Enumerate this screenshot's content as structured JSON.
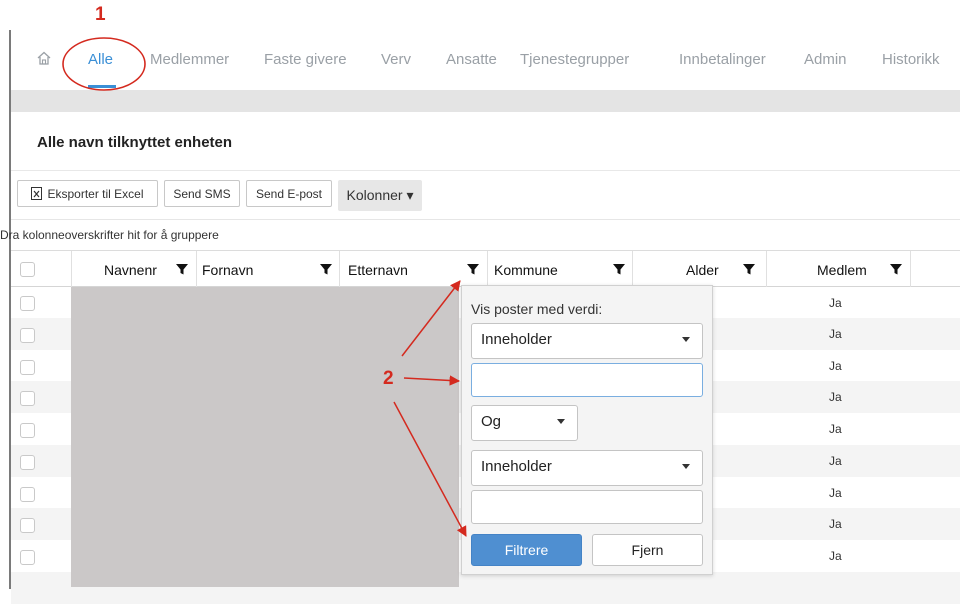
{
  "nav": {
    "items": [
      {
        "label": "Alle",
        "active": true
      },
      {
        "label": "Medlemmer"
      },
      {
        "label": "Faste givere"
      },
      {
        "label": "Verv"
      },
      {
        "label": "Ansatte"
      },
      {
        "label": "Tjenestegrupper"
      },
      {
        "label": "Innbetalinger"
      },
      {
        "label": "Admin"
      },
      {
        "label": "Historikk"
      }
    ],
    "home_icon": "home-icon"
  },
  "panel": {
    "title": "Alle navn tilknyttet enheten"
  },
  "toolbar": {
    "export_label": "Eksporter til Excel",
    "sms_label": "Send SMS",
    "email_label": "Send E-post",
    "columns_label": "Kolonner ▾"
  },
  "grid": {
    "group_hint": "Dra kolonneoverskrifter hit for å gruppere",
    "columns": [
      "Navnenr",
      "Fornavn",
      "Etternavn",
      "Kommune",
      "Alder",
      "Medlem"
    ],
    "medlem_values": [
      "Ja",
      "Ja",
      "Ja",
      "Ja",
      "Ja",
      "Ja",
      "Ja",
      "Ja",
      "Ja"
    ]
  },
  "filter_popup": {
    "label": "Vis poster med verdi:",
    "operator1": "Inneholder",
    "value1": "",
    "logic": "Og",
    "operator2": "Inneholder",
    "value2": "",
    "apply_label": "Filtrere",
    "clear_label": "Fjern"
  },
  "annotations": {
    "marker1": "1",
    "marker2": "2",
    "color": "#d42a1f"
  },
  "colors": {
    "accent": "#3a8fd6",
    "apply_button": "#4f8fd1"
  }
}
